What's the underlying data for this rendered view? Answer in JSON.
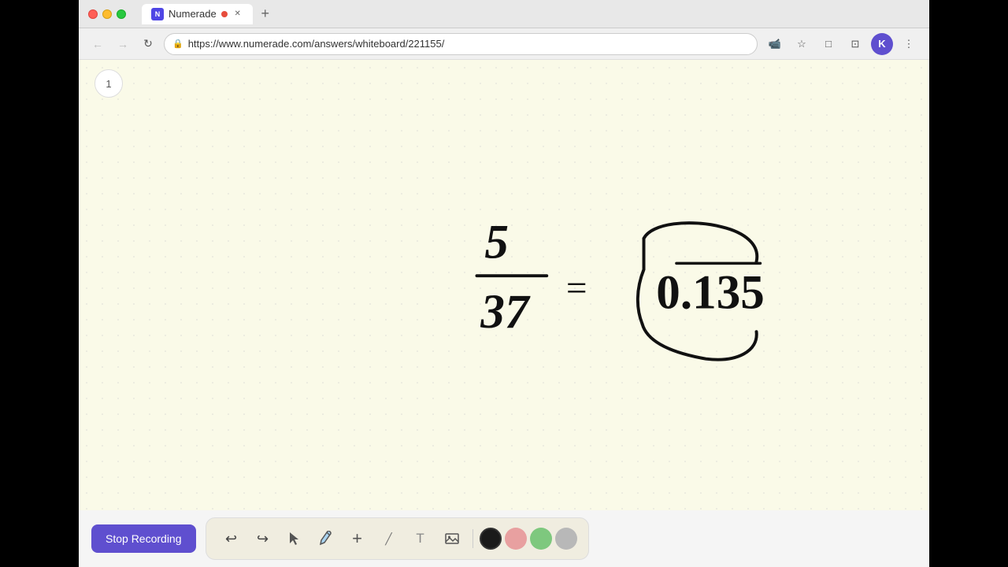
{
  "browser": {
    "tab_title": "Numerade",
    "tab_favicon": "N",
    "url": "https://www.numerade.com/answers/whiteboard/221155/",
    "new_tab_symbol": "+",
    "nav": {
      "back": "←",
      "forward": "→",
      "refresh": "↻",
      "lock_icon": "🔒"
    },
    "profile_letter": "K",
    "nav_actions": [
      "📹",
      "☆",
      "□",
      "⊡",
      "⋮"
    ]
  },
  "page": {
    "page_number": "1",
    "background_color": "#fafae8"
  },
  "toolbar": {
    "stop_recording_label": "Stop Recording",
    "stop_recording_color": "#5f4fcf",
    "tools": [
      {
        "name": "undo",
        "icon": "↩",
        "label": "Undo"
      },
      {
        "name": "redo",
        "icon": "↪",
        "label": "Redo"
      },
      {
        "name": "select",
        "icon": "▷",
        "label": "Select"
      },
      {
        "name": "pen",
        "icon": "✏",
        "label": "Pen"
      },
      {
        "name": "add",
        "icon": "+",
        "label": "Add"
      },
      {
        "name": "eraser",
        "icon": "╱",
        "label": "Eraser"
      },
      {
        "name": "text",
        "icon": "T",
        "label": "Text"
      },
      {
        "name": "image",
        "icon": "🖼",
        "label": "Image"
      }
    ],
    "colors": [
      {
        "name": "black",
        "value": "#1a1a1a",
        "active": true
      },
      {
        "name": "pink",
        "value": "#e8a0a0",
        "active": false
      },
      {
        "name": "green",
        "value": "#7ec87e",
        "active": false
      },
      {
        "name": "gray",
        "value": "#b0b0b0",
        "active": false
      }
    ]
  },
  "math_content": {
    "equation": "5/37 = 0.̄1̄3̄5̄"
  }
}
